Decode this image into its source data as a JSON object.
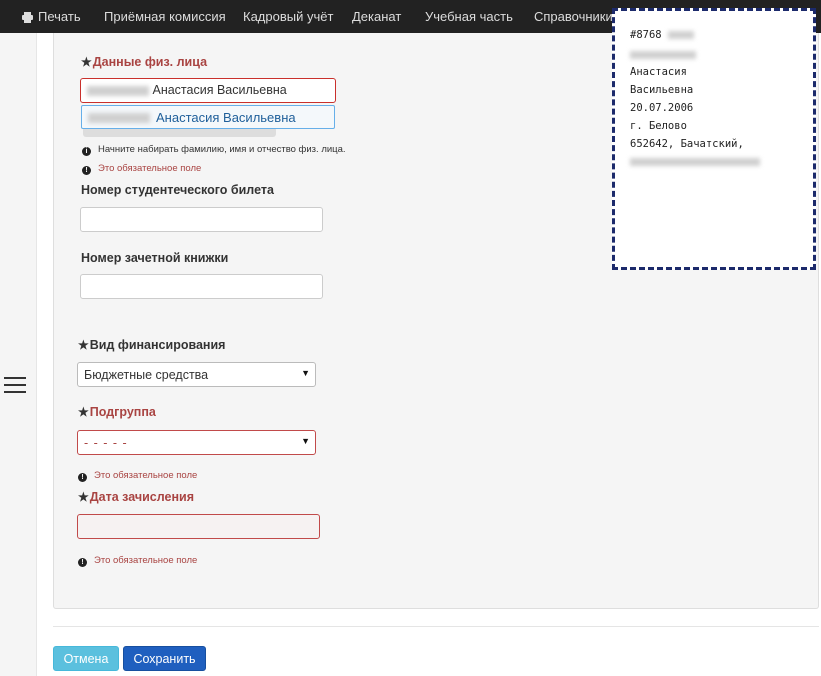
{
  "navbar": {
    "print": "Печать",
    "items": [
      "Приёмная комиссия",
      "Кадровый учёт",
      "Деканат",
      "Учебная часть",
      "Справочники"
    ]
  },
  "form": {
    "person": {
      "label": "Данные физ. лица",
      "value": "Анастасия Васильевна",
      "suggestion": "Анастасия Васильевна",
      "hint": "Начните набирать фамилию, имя и отчество физ. лица.",
      "error": "Это обязательное поле"
    },
    "student_id": {
      "label": "Номер студентеческого билета",
      "value": ""
    },
    "record_book": {
      "label": "Номер зачетной книжки",
      "value": ""
    },
    "financing": {
      "label": "Вид финансирования",
      "value": "Бюджетные средства"
    },
    "subgroup": {
      "label": "Подгруппа",
      "value": "- - - - -",
      "error": "Это обязательное поле"
    },
    "enroll_date": {
      "label": "Дата зачисления",
      "value": "",
      "error": "Это обязательное поле"
    }
  },
  "buttons": {
    "cancel": "Отмена",
    "save": "Сохранить"
  },
  "card": {
    "lines": [
      "#8768",
      "Анастасия",
      "Васильевна",
      "20.07.2006",
      "г. Белово",
      "652642, Бачатский,"
    ]
  }
}
